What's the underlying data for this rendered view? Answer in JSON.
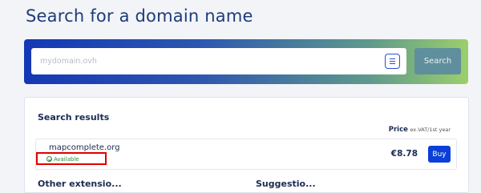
{
  "page": {
    "title": "Search for a domain name"
  },
  "search": {
    "placeholder": "mydomain.ovh",
    "value": "",
    "button_label": "Search"
  },
  "results": {
    "title": "Search results",
    "price_header": "Price",
    "price_note": "ex.VAT/1st year",
    "items": [
      {
        "domain": "mapcomplete.org",
        "status": "Available",
        "price": "€8.78",
        "buy_label": "Buy"
      }
    ]
  },
  "below": {
    "left_heading": "Other extensio...",
    "right_heading": "Suggestio..."
  },
  "colors": {
    "title": "#1e3c77",
    "buy_button": "#0a3fd8",
    "available": "#2f8a2f",
    "highlight_box": "#e00000"
  },
  "icons": [
    "list-icon",
    "check-circle-icon"
  ]
}
